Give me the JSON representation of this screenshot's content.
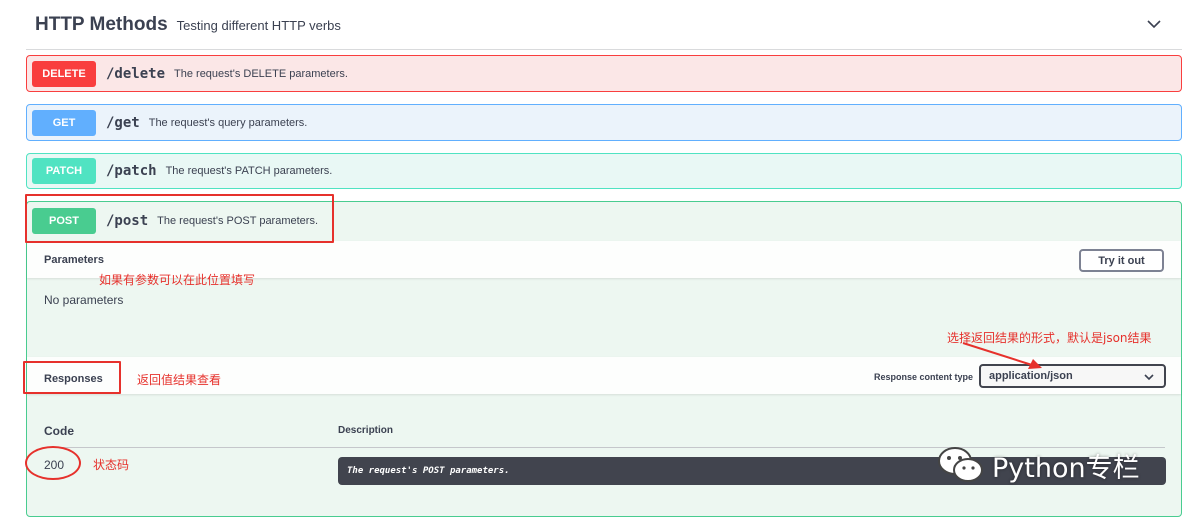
{
  "section": {
    "title": "HTTP Methods",
    "description": "Testing different HTTP verbs"
  },
  "operations": [
    {
      "method": "DELETE",
      "path": "/delete",
      "summary": "The request's DELETE parameters."
    },
    {
      "method": "GET",
      "path": "/get",
      "summary": "The request's query parameters."
    },
    {
      "method": "PATCH",
      "path": "/patch",
      "summary": "The request's PATCH parameters."
    },
    {
      "method": "POST",
      "path": "/post",
      "summary": "The request's POST parameters."
    }
  ],
  "post": {
    "parameters_title": "Parameters",
    "try_it_out": "Try it out",
    "no_parameters": "No parameters",
    "responses_title": "Responses",
    "response_content_type_label": "Response content type",
    "response_content_type_value": "application/json",
    "code_header": "Code",
    "description_header": "Description",
    "responses": [
      {
        "code": "200",
        "description": "The request's POST parameters."
      }
    ]
  },
  "annotations": {
    "params_note": "如果有参数可以在此位置填写",
    "responses_note": "返回值结果查看",
    "content_type_note": "选择返回结果的形式，默认是json结果",
    "status_note": "状态码"
  },
  "watermark": {
    "text": "Python专栏"
  },
  "colors": {
    "delete": "#f93e3e",
    "get": "#61affe",
    "patch": "#50e3c2",
    "post": "#49cc90",
    "annotation": "#e6312c"
  }
}
